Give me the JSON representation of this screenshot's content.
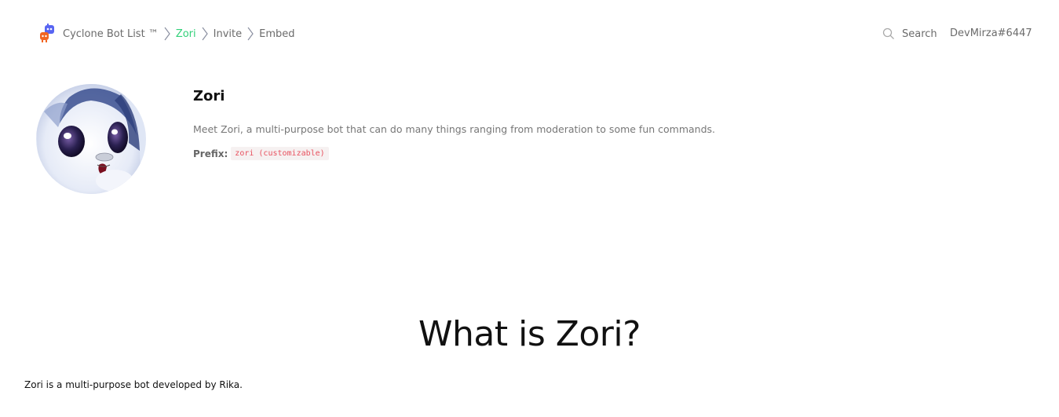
{
  "header": {
    "breadcrumb": [
      "Cyclone Bot List ™",
      "Zori",
      "Invite",
      "Embed"
    ],
    "active_crumb_color": "#33d17a",
    "search_label": "Search",
    "username": "DevMirza#6447"
  },
  "bot": {
    "name": "Zori",
    "description": "Meet Zori, a multi-purpose bot that can do many things ranging from moderation to some fun commands.",
    "prefix_label": "Prefix:",
    "prefix_value": "zori (customizable)"
  },
  "about": {
    "heading": "What is Zori?",
    "text": "Zori is a multi-purpose bot developed by Rika."
  },
  "icons": {
    "logo": "cyclone-logo-icon",
    "separator": "chevron-right-icon",
    "search": "search-icon"
  }
}
